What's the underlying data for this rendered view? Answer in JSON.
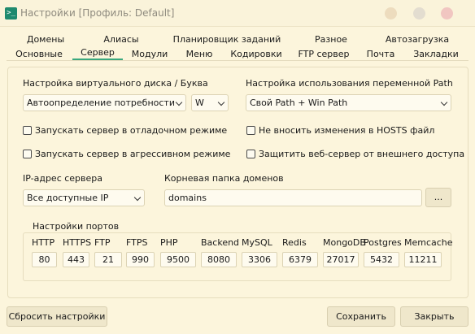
{
  "window": {
    "app_icon_glyph": ">_",
    "title": "Настройки [Профиль: Default]"
  },
  "tabs": {
    "row1": [
      "Домены",
      "Алиасы",
      "Планировщик заданий",
      "Разное",
      "Автозагрузка"
    ],
    "row2": [
      "Основные",
      "Сервер",
      "Модули",
      "Меню",
      "Кодировки",
      "FTP сервер",
      "Почта",
      "Закладки"
    ],
    "active": "Сервер"
  },
  "server": {
    "virtual_disk_label": "Настройка виртуального диска / Буква",
    "virtual_disk_mode": "Автоопределение потребности",
    "virtual_disk_letter": "W",
    "path_label": "Настройка использования переменной Path",
    "path_mode": "Свой Path + Win Path",
    "debug_mode_label": "Запускать сервер в отладочном режиме",
    "aggressive_mode_label": "Запускать сервер в агрессивном режиме",
    "no_hosts_label": "Не вносить изменения в HOSTS файл",
    "protect_label": "Защитить веб-сервер от внешнего доступа",
    "ip_label": "IP-адрес сервера",
    "ip_value": "Все доступные IP",
    "root_label": "Корневая папка доменов",
    "root_value": "domains",
    "browse_label": "..."
  },
  "ports": {
    "group_label": "Настройки портов",
    "items": [
      {
        "name": "HTTP",
        "value": "80"
      },
      {
        "name": "HTTPS",
        "value": "443"
      },
      {
        "name": "FTP",
        "value": "21"
      },
      {
        "name": "FTPS",
        "value": "990"
      },
      {
        "name": "PHP",
        "value": "9500"
      },
      {
        "name": "Backend",
        "value": "8080"
      },
      {
        "name": "MySQL",
        "value": "3306"
      },
      {
        "name": "Redis",
        "value": "6379"
      },
      {
        "name": "MongoDB",
        "value": "27017"
      },
      {
        "name": "Postgres",
        "value": "5432"
      },
      {
        "name": "Memcache",
        "value": "11211"
      }
    ]
  },
  "footer": {
    "reset_label": "Сбросить настройки",
    "save_label": "Сохранить",
    "close_label": "Закрыть"
  }
}
